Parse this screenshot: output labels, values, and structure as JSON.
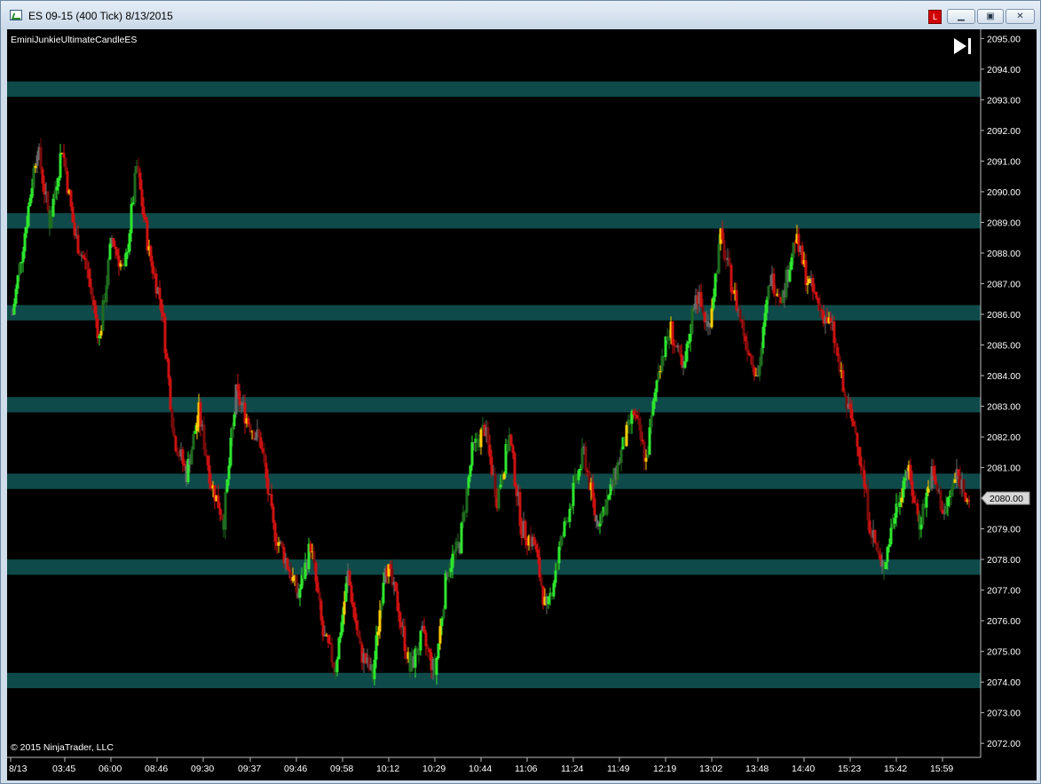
{
  "window": {
    "title": "ES 09-15 (400 Tick)  8/13/2015",
    "buttons": {
      "minimize": "▁",
      "maximize": "▣",
      "close": "✕"
    },
    "red_button": "L"
  },
  "indicator_label": "EminiJunkieUltimateCandleES",
  "copyright": "© 2015 NinjaTrader, LLC",
  "play_icon": "play-to-end-icon",
  "chart_data": {
    "type": "candlestick",
    "title": "",
    "ylim": [
      2071.6,
      2095.3
    ],
    "yticks": [
      2072,
      2073,
      2074,
      2075,
      2076,
      2077,
      2078,
      2079,
      2080,
      2081,
      2082,
      2083,
      2084,
      2085,
      2086,
      2087,
      2088,
      2089,
      2090,
      2091,
      2092,
      2093,
      2094,
      2095
    ],
    "last_price": "2080.00",
    "x_tick_labels": [
      "8/13",
      "03:45",
      "06:00",
      "08:46",
      "09:30",
      "09:37",
      "09:46",
      "09:58",
      "10:12",
      "10:29",
      "10:44",
      "11:06",
      "11:24",
      "11:49",
      "12:19",
      "13:02",
      "13:48",
      "14:40",
      "15:23",
      "15:42",
      "15:59"
    ],
    "zones": [
      {
        "low": 2093.1,
        "high": 2093.6
      },
      {
        "low": 2088.8,
        "high": 2089.3
      },
      {
        "low": 2085.8,
        "high": 2086.3
      },
      {
        "low": 2082.8,
        "high": 2083.3
      },
      {
        "low": 2080.3,
        "high": 2080.8
      },
      {
        "low": 2077.5,
        "high": 2078.0
      },
      {
        "low": 2073.8,
        "high": 2074.3
      }
    ],
    "price_path": [
      2086.0,
      2088.7,
      2091.5,
      2089.0,
      2091.5,
      2088.6,
      2087.5,
      2085.2,
      2088.5,
      2087.3,
      2090.8,
      2088.0,
      2086.3,
      2082.0,
      2080.8,
      2082.8,
      2080.5,
      2079.3,
      2083.4,
      2082.5,
      2081.8,
      2079.0,
      2078.0,
      2076.8,
      2078.5,
      2075.5,
      2074.5,
      2077.5,
      2075.0,
      2074.2,
      2078.0,
      2076.5,
      2074.4,
      2075.5,
      2074.3,
      2077.7,
      2078.5,
      2081.5,
      2082.3,
      2080.0,
      2082.0,
      2079.0,
      2078.5,
      2076.2,
      2078.3,
      2080.0,
      2081.5,
      2079.2,
      2080.0,
      2081.5,
      2082.8,
      2081.2,
      2084.3,
      2085.5,
      2084.0,
      2086.8,
      2085.5,
      2088.5,
      2086.8,
      2085.2,
      2084.0,
      2087.2,
      2086.6,
      2088.5,
      2087.1,
      2086.2,
      2085.5,
      2083.2,
      2082.0,
      2079.2,
      2077.6,
      2079.5,
      2081.0,
      2079.2,
      2080.8,
      2079.5,
      2080.8,
      2080.0
    ],
    "colors": {
      "zone": "#0f4a4a",
      "bright_green": "#2ee62e",
      "dark_green": "#1f6b1f",
      "red": "#cc1111",
      "dark_red": "#7a0c0c",
      "yellow": "#ffcc00",
      "gray": "#6a6a6a",
      "olive": "#8a9a20"
    }
  }
}
